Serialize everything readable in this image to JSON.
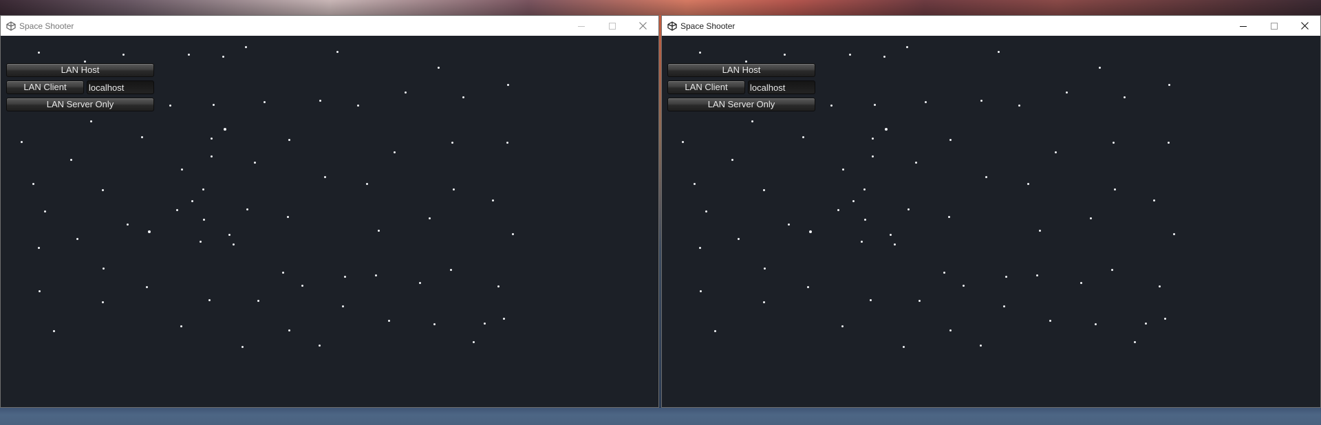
{
  "windows": [
    {
      "title": "Space Shooter",
      "icon": "unity-icon",
      "focused": false,
      "controls": [
        "minimize-icon",
        "maximize-icon",
        "close-icon"
      ],
      "menu": {
        "host_label": "LAN Host",
        "client_label": "LAN Client",
        "address_value": "localhost",
        "server_label": "LAN Server Only"
      }
    },
    {
      "title": "Space Shooter",
      "icon": "unity-icon",
      "focused": true,
      "controls": [
        "minimize-icon",
        "maximize-icon",
        "close-icon"
      ],
      "menu": {
        "host_label": "LAN Host",
        "client_label": "LAN Client",
        "address_value": "localhost",
        "server_label": "LAN Server Only"
      }
    }
  ],
  "colors": {
    "game_background": "#1c2027",
    "star": "#f2f4f7",
    "button_text": "#e8e8e8"
  }
}
